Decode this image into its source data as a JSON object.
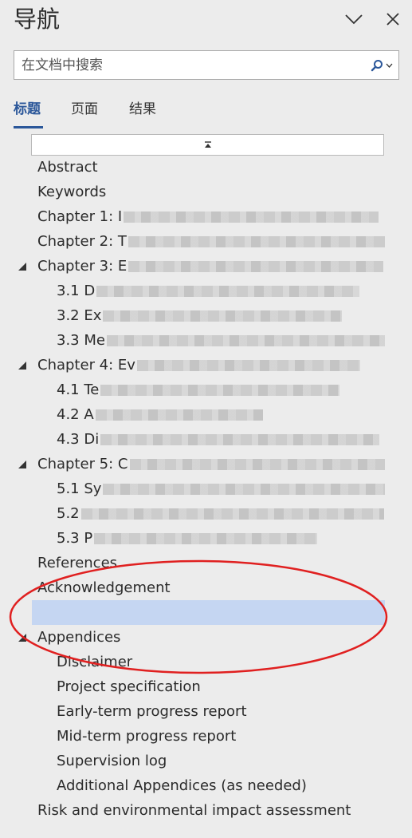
{
  "pane": {
    "title": "导航",
    "options_icon": "chevron-down-icon",
    "close_icon": "close-icon"
  },
  "search": {
    "placeholder": "在文档中搜索",
    "value": ""
  },
  "tabs": [
    {
      "label": "标题",
      "active": true
    },
    {
      "label": "页面",
      "active": false
    },
    {
      "label": "结果",
      "active": false
    }
  ],
  "headings": [
    {
      "label": "Abstract",
      "level": 1
    },
    {
      "label": "Keywords",
      "level": 1
    },
    {
      "label": "Chapter 1: I",
      "level": 1,
      "redacted": true
    },
    {
      "label": "Chapter 2: T",
      "level": 1,
      "redacted": true
    },
    {
      "label": "Chapter 3: E",
      "level": 1,
      "redacted": true,
      "expanded": true
    },
    {
      "label": "3.1 D",
      "level": 2,
      "redacted": true
    },
    {
      "label": "3.2 Ex",
      "level": 2,
      "redacted": true
    },
    {
      "label": "3.3 Me",
      "level": 2,
      "redacted": true
    },
    {
      "label": "Chapter 4: Ev",
      "level": 1,
      "redacted": true,
      "expanded": true
    },
    {
      "label": "4.1 Te",
      "level": 2,
      "redacted": true
    },
    {
      "label": "4.2 A",
      "level": 2,
      "redacted": true
    },
    {
      "label": "4.3 Di",
      "level": 2,
      "redacted": true
    },
    {
      "label": "Chapter 5: C",
      "level": 1,
      "redacted": true,
      "expanded": true
    },
    {
      "label": "5.1 Sy",
      "level": 2,
      "redacted": true
    },
    {
      "label": "5.2",
      "level": 2,
      "redacted": true
    },
    {
      "label": "5.3 P",
      "level": 2,
      "redacted": true
    },
    {
      "label": "References",
      "level": 1
    },
    {
      "label": "Acknowledgement",
      "level": 1
    },
    {
      "label": "",
      "level": 1,
      "selected": true
    },
    {
      "label": "Appendices",
      "level": 1,
      "expanded": true
    },
    {
      "label": "Disclaimer",
      "level": 2
    },
    {
      "label": "Project specification",
      "level": 2
    },
    {
      "label": "Early-term progress report",
      "level": 2
    },
    {
      "label": "Mid-term progress report",
      "level": 2
    },
    {
      "label": "Supervision log",
      "level": 2
    },
    {
      "label": "Additional Appendices (as needed)",
      "level": 2
    },
    {
      "label": "Risk and environmental impact assessment",
      "level": 1
    }
  ],
  "colors": {
    "accent": "#2b579a",
    "selection": "#c5d6f2",
    "annotation": "#e02020",
    "pane_bg": "#ececec"
  }
}
